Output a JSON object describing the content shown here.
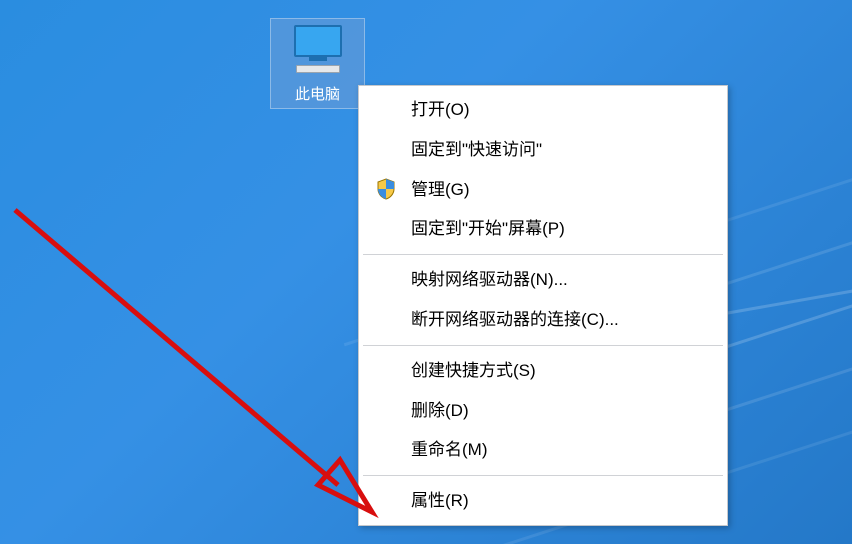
{
  "desktop_icon": {
    "label": "此电脑"
  },
  "context_menu": {
    "items": [
      {
        "label": "打开(O)",
        "has_icon": false
      },
      {
        "label": "固定到\"快速访问\"",
        "has_icon": false
      },
      {
        "label": "管理(G)",
        "has_icon": true,
        "icon": "shield"
      },
      {
        "label": "固定到\"开始\"屏幕(P)",
        "has_icon": false
      }
    ],
    "items2": [
      {
        "label": "映射网络驱动器(N)...",
        "has_icon": false
      },
      {
        "label": "断开网络驱动器的连接(C)...",
        "has_icon": false
      }
    ],
    "items3": [
      {
        "label": "创建快捷方式(S)",
        "has_icon": false
      },
      {
        "label": "删除(D)",
        "has_icon": false
      },
      {
        "label": "重命名(M)",
        "has_icon": false
      }
    ],
    "items4": [
      {
        "label": "属性(R)",
        "has_icon": false
      }
    ]
  },
  "annotation": {
    "arrow_color": "#d80e0e"
  }
}
